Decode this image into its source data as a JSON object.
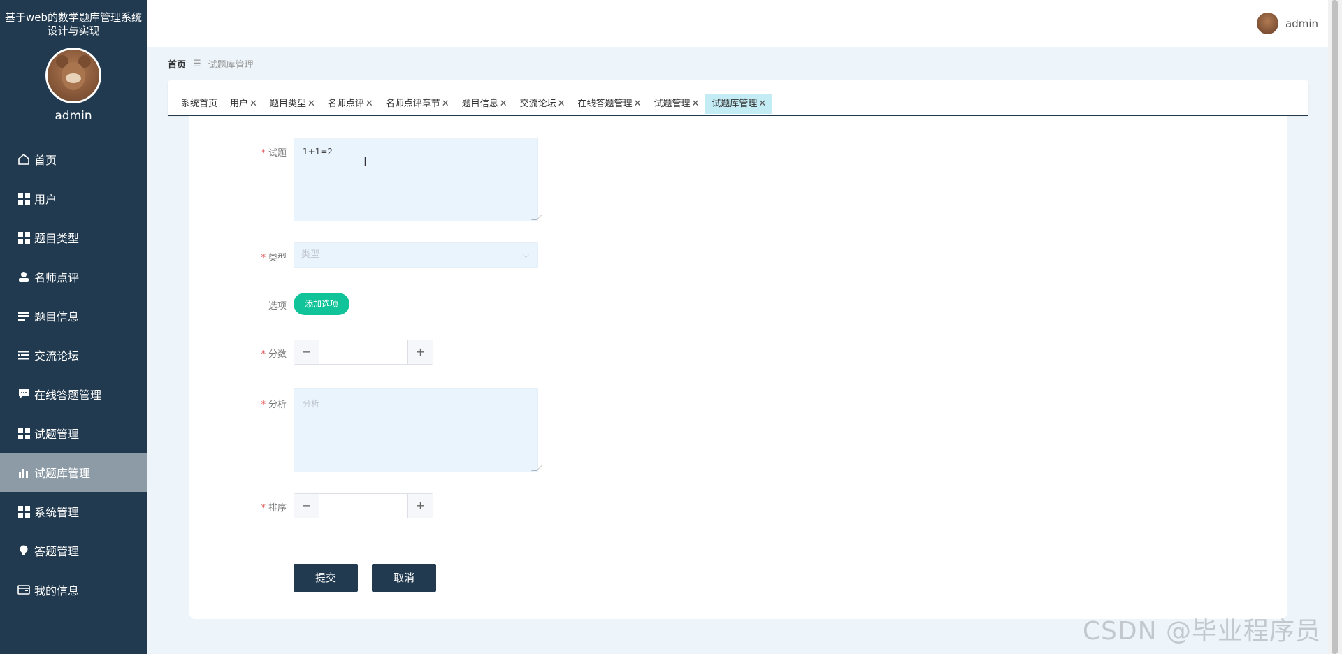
{
  "app": {
    "title": "基于web的数学题库管理系统设计与实现",
    "user": "admin"
  },
  "sidebar": {
    "username": "admin",
    "items": [
      {
        "label": "首页",
        "icon": "home-icon"
      },
      {
        "label": "用户",
        "icon": "grid-icon"
      },
      {
        "label": "题目类型",
        "icon": "grid-icon"
      },
      {
        "label": "名师点评",
        "icon": "user-icon"
      },
      {
        "label": "题目信息",
        "icon": "list-icon"
      },
      {
        "label": "交流论坛",
        "icon": "list-indent-icon"
      },
      {
        "label": "在线答题管理",
        "icon": "chat-icon"
      },
      {
        "label": "试题管理",
        "icon": "grid-icon"
      },
      {
        "label": "试题库管理",
        "icon": "bar-chart-icon",
        "active": true
      },
      {
        "label": "系统管理",
        "icon": "grid-icon"
      },
      {
        "label": "答题管理",
        "icon": "bulb-icon"
      },
      {
        "label": "我的信息",
        "icon": "wallet-icon"
      }
    ]
  },
  "breadcrumb": {
    "home": "首页",
    "separator": "☰",
    "current": "试题库管理"
  },
  "tabs": [
    {
      "label": "系统首页",
      "closable": false
    },
    {
      "label": "用户",
      "closable": true
    },
    {
      "label": "题目类型",
      "closable": true
    },
    {
      "label": "名师点评",
      "closable": true
    },
    {
      "label": "名师点评章节",
      "closable": true
    },
    {
      "label": "题目信息",
      "closable": true
    },
    {
      "label": "交流论坛",
      "closable": true
    },
    {
      "label": "在线答题管理",
      "closable": true
    },
    {
      "label": "试题管理",
      "closable": true
    },
    {
      "label": "试题库管理",
      "closable": true,
      "active": true
    }
  ],
  "form": {
    "question": {
      "label": "试题",
      "value": "1+1=2"
    },
    "type": {
      "label": "类型",
      "placeholder": "类型"
    },
    "options": {
      "label": "选项",
      "button": "添加选项"
    },
    "score": {
      "label": "分数",
      "minus": "−",
      "plus": "+"
    },
    "analysis": {
      "label": "分析",
      "placeholder": "分析"
    },
    "sort": {
      "label": "排序",
      "minus": "−",
      "plus": "+"
    },
    "required_mark": "*",
    "submit": "提交",
    "cancel": "取消"
  },
  "watermark": "CSDN @毕业程序员",
  "colors": {
    "sidebar": "#213a4f",
    "accent": "#10c398",
    "active_tab": "#c4ecf4",
    "page_bg": "#edf5fb"
  }
}
